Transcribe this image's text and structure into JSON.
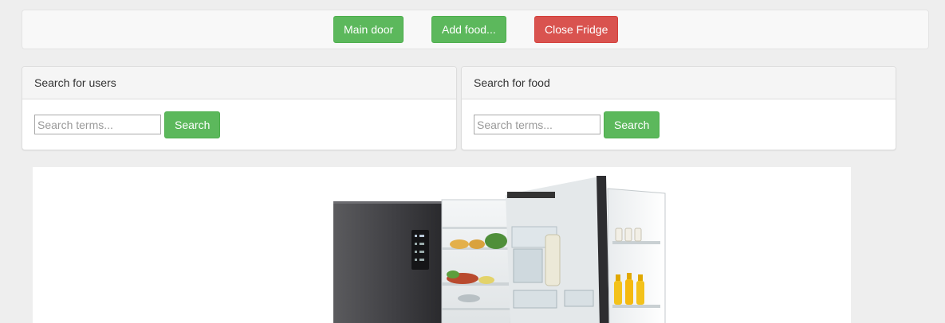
{
  "toolbar": {
    "main_door_label": "Main door",
    "add_food_label": "Add food...",
    "close_fridge_label": "Close Fridge"
  },
  "users_panel": {
    "title": "Search for users",
    "placeholder": "Search terms...",
    "button_label": "Search"
  },
  "food_panel": {
    "title": "Search for food",
    "placeholder": "Search terms...",
    "button_label": "Search"
  },
  "image": {
    "subject": "open-refrigerator-image"
  },
  "colors": {
    "success": "#5cb85c",
    "danger": "#d9534f",
    "background": "#eeeeee"
  }
}
